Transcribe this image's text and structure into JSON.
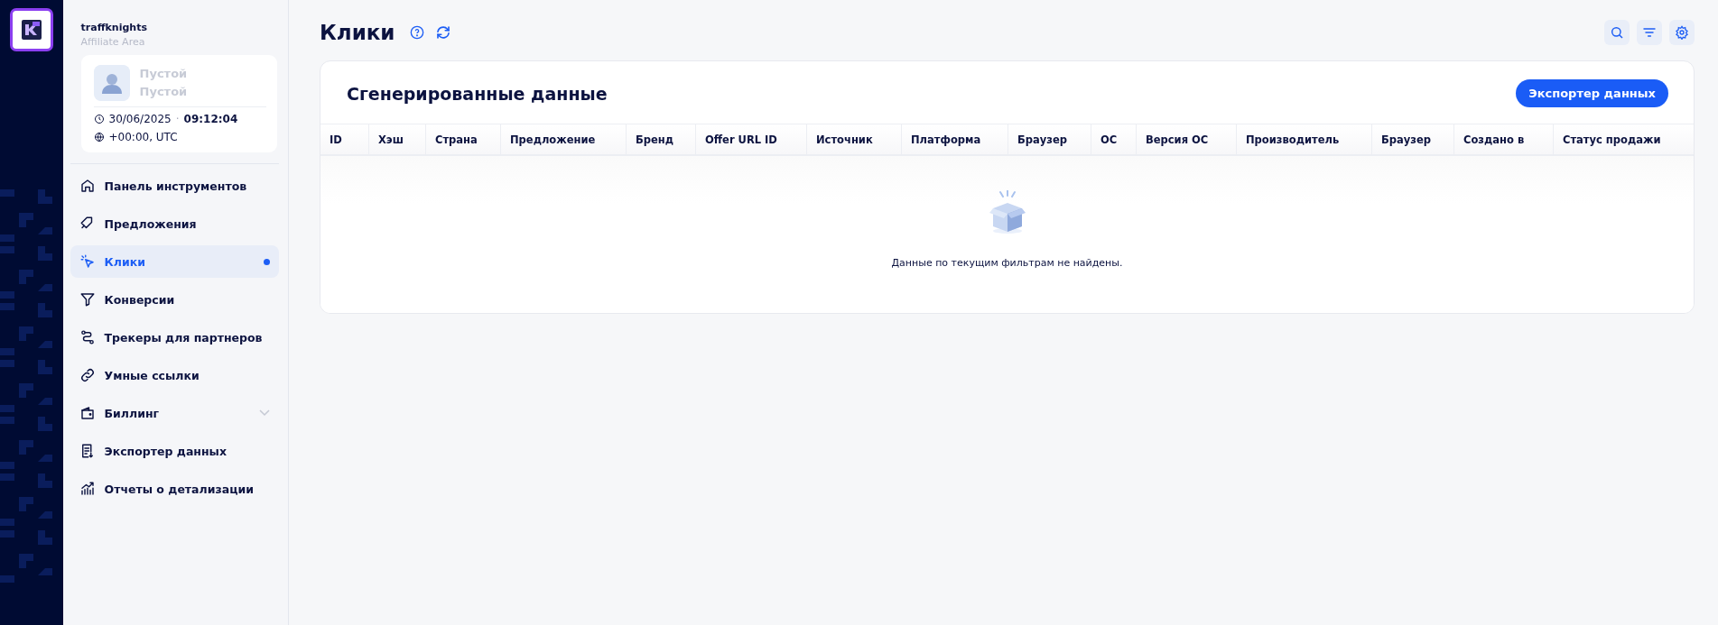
{
  "brand": {
    "name": "traffknights",
    "subtitle": "Affiliate Area"
  },
  "profile": {
    "name": "Пустой",
    "role": "Пустой",
    "date": "30/06/2025",
    "separator": "·",
    "time": "09:12:04",
    "timezone": "+00:00, UTC"
  },
  "nav": [
    {
      "label": "Панель инструментов",
      "selected": false
    },
    {
      "label": "Предложения",
      "selected": false
    },
    {
      "label": "Клики",
      "selected": true
    },
    {
      "label": "Конверсии",
      "selected": false
    },
    {
      "label": "Трекеры для партнеров",
      "selected": false
    },
    {
      "label": "Умные ссылки",
      "selected": false
    },
    {
      "label": "Биллинг",
      "selected": false,
      "expanded": false
    },
    {
      "label": "Экспортер данных",
      "selected": false
    },
    {
      "label": "Отчеты о детализации",
      "selected": false
    }
  ],
  "page": {
    "title": "Клики"
  },
  "card": {
    "title": "Сгенерированные данные",
    "export_button": "Экспортер данных"
  },
  "table": {
    "columns": [
      "ID",
      "Хэш",
      "Страна",
      "Предложение",
      "Бренд",
      "Offer URL ID",
      "Источник",
      "Платформа",
      "Браузер",
      "ОС",
      "Версия ОС",
      "Производитель",
      "Браузер",
      "Создано в",
      "Статус продажи"
    ],
    "empty_message": "Данные по текущим фильтрам не найдены."
  }
}
